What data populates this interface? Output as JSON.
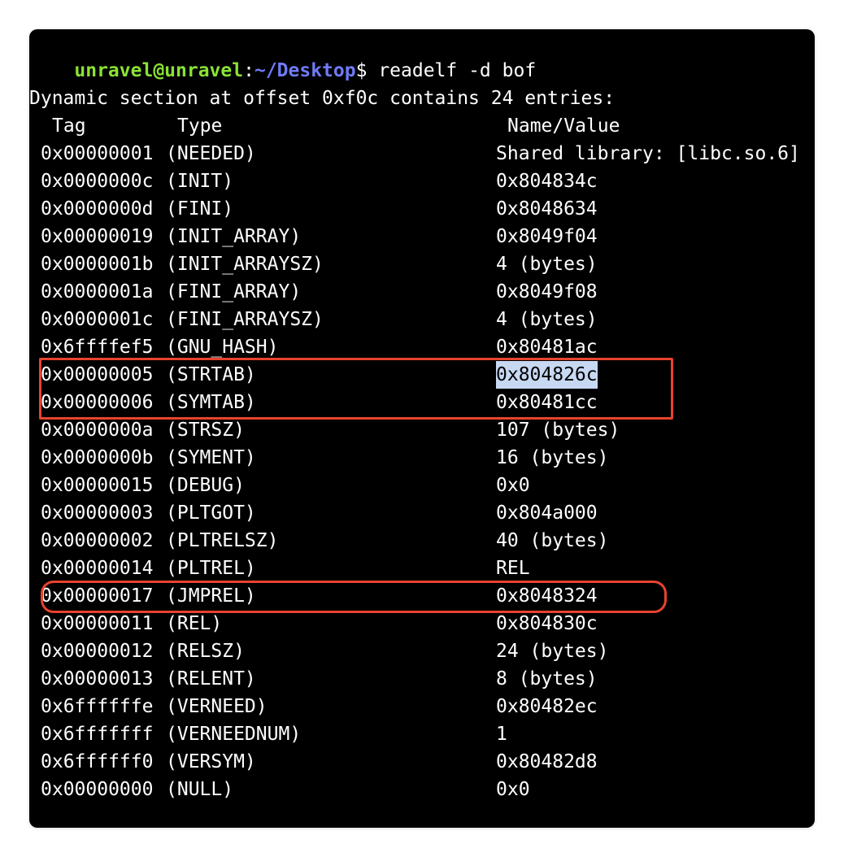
{
  "prompt": {
    "user_host": "unravel@unravel",
    "sep": ":",
    "path": "~/Desktop",
    "symbol": "$",
    "command": "readelf -d bof"
  },
  "output": {
    "summary": "Dynamic section at offset 0xf0c contains 24 entries:",
    "headers": {
      "tag": "Tag",
      "type": "Type",
      "value": "Name/Value"
    },
    "rows": [
      {
        "tag": "0x00000001",
        "type": "(NEEDED)",
        "value": "Shared library: [libc.so.6]"
      },
      {
        "tag": "0x0000000c",
        "type": "(INIT)",
        "value": "0x804834c"
      },
      {
        "tag": "0x0000000d",
        "type": "(FINI)",
        "value": "0x8048634"
      },
      {
        "tag": "0x00000019",
        "type": "(INIT_ARRAY)",
        "value": "0x8049f04"
      },
      {
        "tag": "0x0000001b",
        "type": "(INIT_ARRAYSZ)",
        "value": "4 (bytes)"
      },
      {
        "tag": "0x0000001a",
        "type": "(FINI_ARRAY)",
        "value": "0x8049f08"
      },
      {
        "tag": "0x0000001c",
        "type": "(FINI_ARRAYSZ)",
        "value": "4 (bytes)"
      },
      {
        "tag": "0x6ffffef5",
        "type": "(GNU_HASH)",
        "value": "0x80481ac"
      },
      {
        "tag": "0x00000005",
        "type": "(STRTAB)",
        "value": "0x804826c"
      },
      {
        "tag": "0x00000006",
        "type": "(SYMTAB)",
        "value": "0x80481cc"
      },
      {
        "tag": "0x0000000a",
        "type": "(STRSZ)",
        "value": "107 (bytes)"
      },
      {
        "tag": "0x0000000b",
        "type": "(SYMENT)",
        "value": "16 (bytes)"
      },
      {
        "tag": "0x00000015",
        "type": "(DEBUG)",
        "value": "0x0"
      },
      {
        "tag": "0x00000003",
        "type": "(PLTGOT)",
        "value": "0x804a000"
      },
      {
        "tag": "0x00000002",
        "type": "(PLTRELSZ)",
        "value": "40 (bytes)"
      },
      {
        "tag": "0x00000014",
        "type": "(PLTREL)",
        "value": "REL"
      },
      {
        "tag": "0x00000017",
        "type": "(JMPREL)",
        "value": "0x8048324"
      },
      {
        "tag": "0x00000011",
        "type": "(REL)",
        "value": "0x804830c"
      },
      {
        "tag": "0x00000012",
        "type": "(RELSZ)",
        "value": "24 (bytes)"
      },
      {
        "tag": "0x00000013",
        "type": "(RELENT)",
        "value": "8 (bytes)"
      },
      {
        "tag": "0x6ffffffe",
        "type": "(VERNEED)",
        "value": "0x80482ec"
      },
      {
        "tag": "0x6fffffff",
        "type": "(VERNEEDNUM)",
        "value": "1"
      },
      {
        "tag": "0x6ffffff0",
        "type": "(VERSYM)",
        "value": "0x80482d8"
      },
      {
        "tag": "0x00000000",
        "type": "(NULL)",
        "value": "0x0"
      }
    ]
  },
  "colors": {
    "background": "#000000",
    "text": "#ffffff",
    "prompt_user": "#8ae234",
    "prompt_path": "#6f7bf7",
    "selection": "#c7d8f2",
    "annotation_box": "#e8432f"
  }
}
